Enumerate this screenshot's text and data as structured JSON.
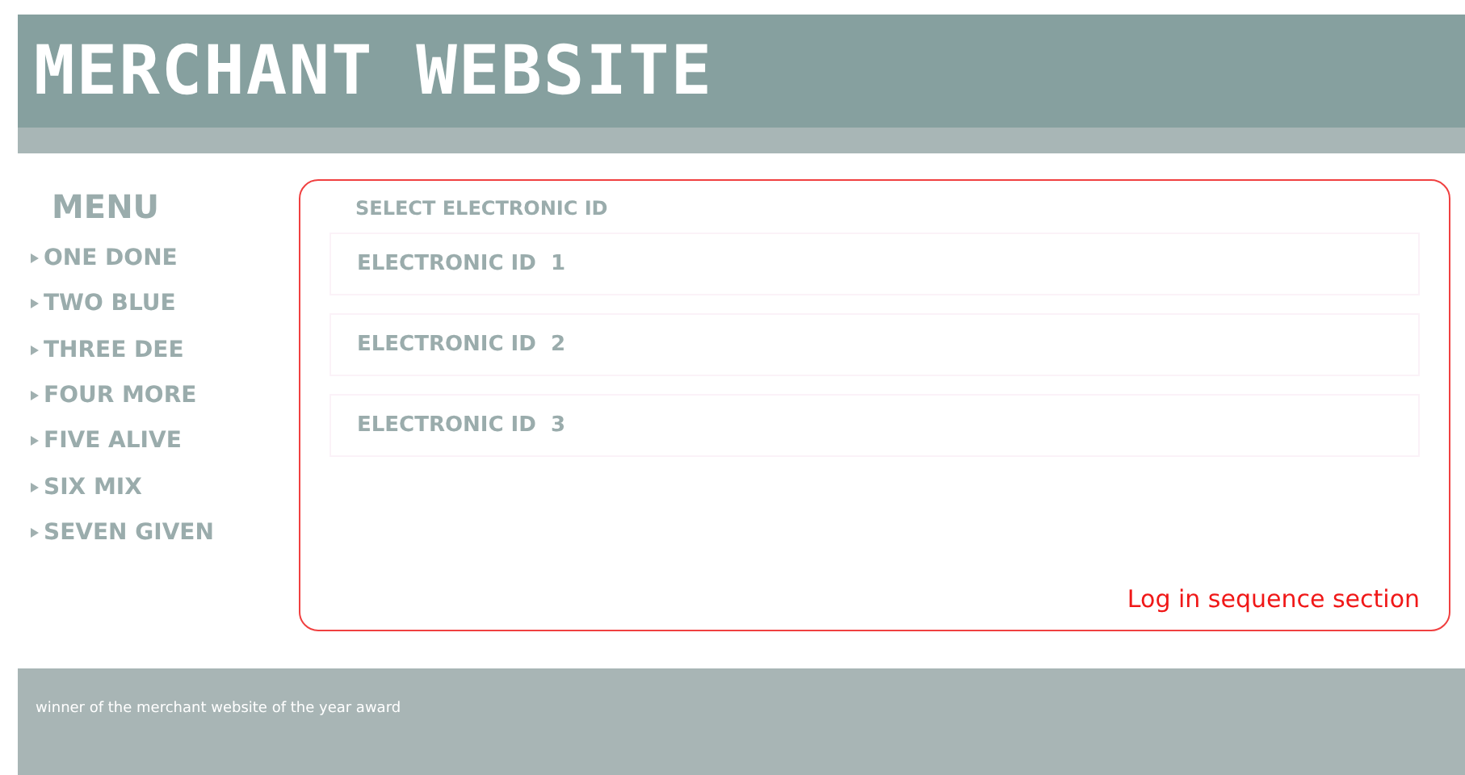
{
  "header": {
    "title": "MERCHANT WEBSITE"
  },
  "menu": {
    "title": "MENU",
    "items": [
      {
        "label": "ONE DONE"
      },
      {
        "label": "TWO BLUE"
      },
      {
        "label": "THREE DEE"
      },
      {
        "label": "FOUR MORE"
      },
      {
        "label": "FIVE ALIVE"
      },
      {
        "label": "SIX MIX"
      },
      {
        "label": "SEVEN GIVEN"
      }
    ]
  },
  "section": {
    "heading": "SELECT ELECTRONIC ID",
    "options": [
      {
        "label": "ELECTRONIC ID  1"
      },
      {
        "label": "ELECTRONIC ID  2"
      },
      {
        "label": "ELECTRONIC ID  3"
      }
    ],
    "caption": "Log in sequence section"
  },
  "footer": {
    "text": "winner of the merchant website of the year award"
  }
}
